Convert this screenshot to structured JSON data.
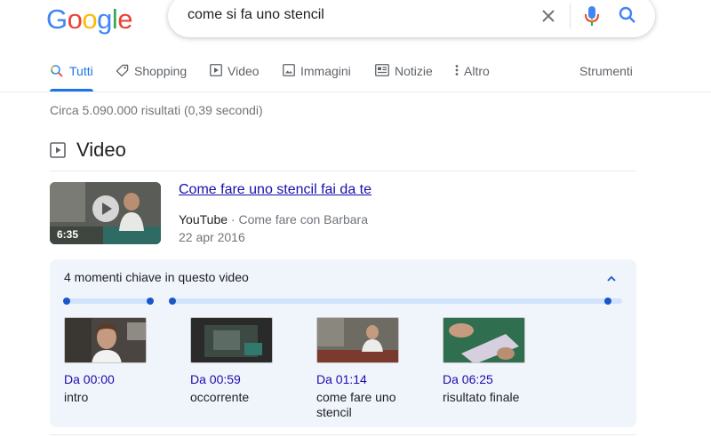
{
  "logo": {
    "letters": [
      "G",
      "o",
      "o",
      "g",
      "l",
      "e"
    ],
    "colors": [
      "#4285F4",
      "#EA4335",
      "#FBBC05",
      "#4285F4",
      "#34A853",
      "#EA4335"
    ]
  },
  "search": {
    "query": "come si fa uno stencil"
  },
  "tabs": [
    {
      "label": "Tutti",
      "icon": "search-icon",
      "active": true
    },
    {
      "label": "Shopping",
      "icon": "tag-icon"
    },
    {
      "label": "Video",
      "icon": "play-icon"
    },
    {
      "label": "Immagini",
      "icon": "image-icon"
    },
    {
      "label": "Notizie",
      "icon": "news-icon"
    },
    {
      "label": "Altro",
      "icon": "more-vert-icon"
    },
    {
      "label": "Strumenti"
    }
  ],
  "stats": "Circa 5.090.000 risultati (0,39 secondi)",
  "video_section": {
    "heading": "Video",
    "result": {
      "title": "Come fare uno stencil fai da te",
      "duration": "6:35",
      "source": "YouTube",
      "separator": "·",
      "channel": "Come fare con Barbara",
      "date": "22 apr 2016"
    },
    "key_moments": {
      "title": "4 momenti chiave in questo video",
      "items": [
        {
          "time": "Da 00:00",
          "label": "intro"
        },
        {
          "time": "Da 00:59",
          "label": "occorrente"
        },
        {
          "time": "Da 01:14",
          "label": "come fare uno stencil"
        },
        {
          "time": "Da 06:25",
          "label": "risultato finale"
        }
      ]
    }
  },
  "colors": {
    "accent": "#1a73e8",
    "link": "#1a0dab",
    "panel_bg": "#f0f4fb",
    "timeline_dot": "#1a56c8"
  }
}
